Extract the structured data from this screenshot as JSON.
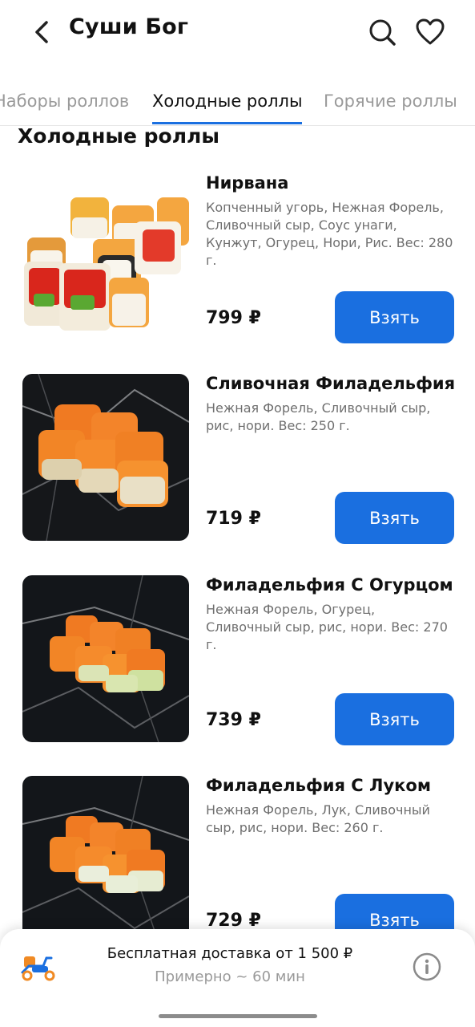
{
  "header": {
    "title": "Суши Бог",
    "back_icon": "chevron-left-icon",
    "search_icon": "search-icon",
    "favorite_icon": "heart-icon"
  },
  "tabs": [
    {
      "label": "Наборы роллов",
      "active": false
    },
    {
      "label": "Холодные роллы",
      "active": true
    },
    {
      "label": "Горячие роллы",
      "active": false
    }
  ],
  "section_title": "Холодные роллы",
  "products": [
    {
      "name": "Нирвана",
      "description": "Копченный угорь, Нежная Форель, Сливочный сыр, Соус унаги, Кунжут, Огурец, Нори, Рис. Вес: 280 г.",
      "price": "799 ₽",
      "button": "Взять"
    },
    {
      "name": "Сливочная Филадельфия",
      "description": "Нежная Форель, Сливочный сыр, рис, нори. Вес: 250 г.",
      "price": "719 ₽",
      "button": "Взять"
    },
    {
      "name": "Филадельфия С Огурцом",
      "description": "Нежная Форель, Огурец, Сливочный сыр, рис, нори. Вес: 270 г.",
      "price": "739 ₽",
      "button": "Взять"
    },
    {
      "name": "Филадельфия С Луком",
      "description": "Нежная Форель, Лук, Сливочный сыр, рис, нори. Вес: 260 г.",
      "price": "729 ₽",
      "button": "Взять"
    }
  ],
  "footer": {
    "delivery_text": "Бесплатная доставка от 1 500 ₽",
    "delivery_time": "Примерно ~ 60 мин",
    "scooter_icon": "scooter-icon",
    "info_icon": "info-icon"
  },
  "colors": {
    "accent": "#1a6fe0",
    "muted_text": "#9a9a9a",
    "scooter_orange": "#f08a24"
  }
}
